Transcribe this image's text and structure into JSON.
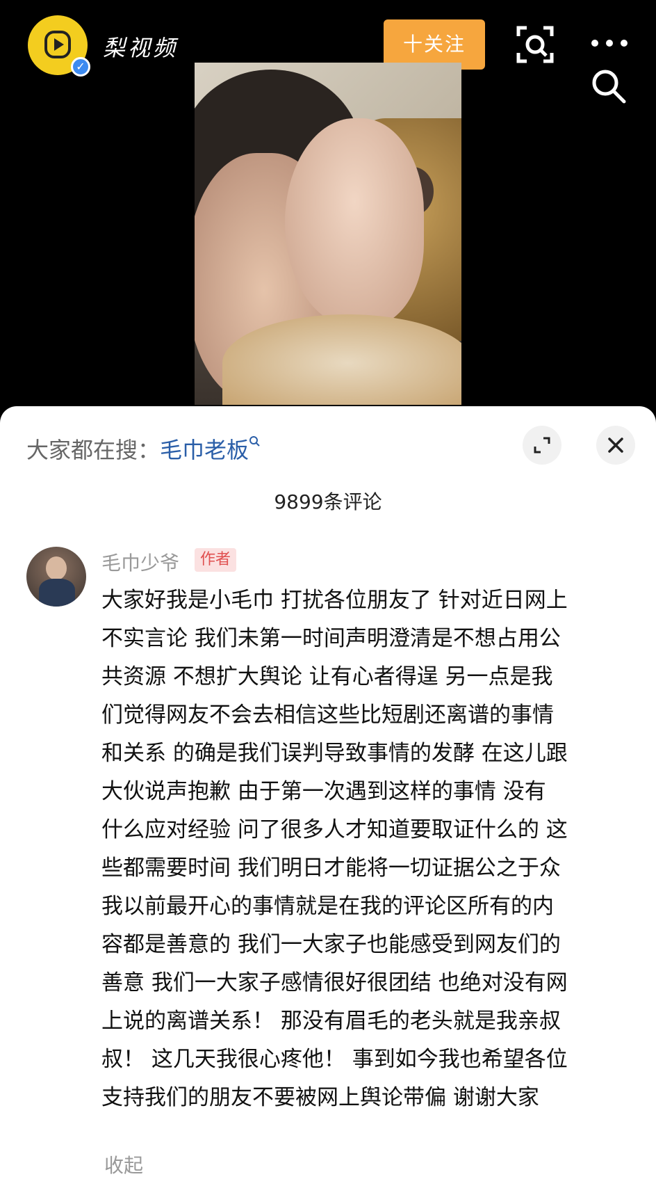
{
  "header": {
    "channel_name": "梨视频",
    "follow_label": "十关注",
    "verified_badge": "✓",
    "icons": [
      "logo-icon",
      "scan-icon",
      "more-icon",
      "search-icon"
    ]
  },
  "comments_panel": {
    "hot_search_prefix": "大家都在搜：",
    "hot_search_keyword": "毛巾老板",
    "hot_search_icon": "search-mini-icon",
    "comment_count": "9899条评论",
    "comment": {
      "username": "毛巾少爷",
      "author_tag": "作者",
      "lines": [
        "大家好我是小毛巾 打扰各位朋友了 针对近日网上",
        "不实言论 我们未第一时间声明澄清是不想占用公",
        "共资源 不想扩大舆论 让有心者得逞 另一点是我",
        "们觉得网友不会去相信这些比短剧还离谱的事情",
        "和关系 的确是我们误判导致事情的发酵 在这儿跟",
        "大伙说声抱歉  由于第一次遇到这样的事情 没有",
        "什么应对经验 问了很多人才知道要取证什么的 这",
        "些都需要时间 我们明日才能将一切证据公之于众",
        "我以前最开心的事情就是在我的评论区所有的内",
        "容都是善意的 我们一大家子也能感受到网友们的",
        "善意 我们一大家子感情很好很团结 也绝对没有网",
        "上说的离谱关系！ 那没有眉毛的老头就是我亲叔",
        "叔！ 这几天我很心疼他！ 事到如今我也希望各位",
        "支持我们的朋友不要被网上舆论带偏 谢谢大家"
      ],
      "collapse_label": "收起"
    }
  },
  "colors": {
    "follow_button": "#f6a63e",
    "keyword_link": "#2a5ea8",
    "author_tag_bg": "#fbe1e1",
    "author_tag_text": "#e05050",
    "logo": "#f3cd1f"
  }
}
